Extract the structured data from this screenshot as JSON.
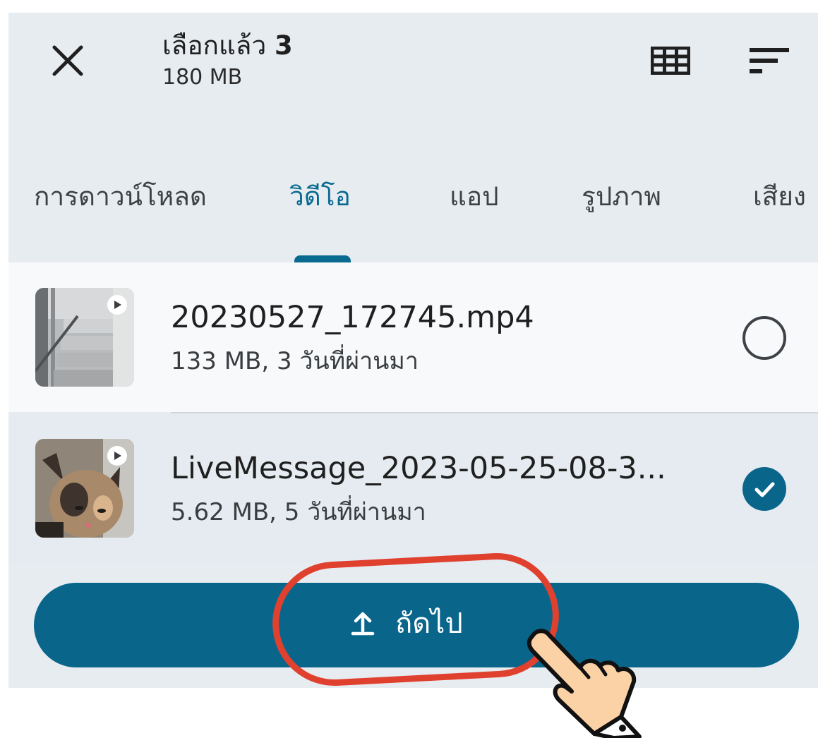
{
  "header": {
    "title_prefix": "เลือกแล้ว",
    "selected_count": "3",
    "total_size": "180 MB"
  },
  "tabs": [
    {
      "label": "การดาวน์โหลด",
      "active": false
    },
    {
      "label": "วิดีโอ",
      "active": true
    },
    {
      "label": "แอป",
      "active": false
    },
    {
      "label": "รูปภาพ",
      "active": false
    },
    {
      "label": "เสียง",
      "active": false
    }
  ],
  "files": [
    {
      "name": "20230527_172745.mp4",
      "meta": "133 MB, 3 วันที่ผ่านมา",
      "selected": false
    },
    {
      "name": "LiveMessage_2023-05-25-08-3...",
      "meta": "5.62 MB, 5 วันที่ผ่านมา",
      "selected": true
    }
  ],
  "next_button": {
    "label": "ถัดไป",
    "icon": "upload-icon"
  },
  "icons": {
    "close": "close-icon",
    "view": "grid-view-icon",
    "sort": "sort-icon",
    "play": "play-icon",
    "check": "check-icon",
    "pointer": "hand-pointer-icon"
  },
  "colors": {
    "accent": "#0a658b",
    "active_tab": "#086a8f",
    "highlight": "#e0412f",
    "background": "#e7ecf1"
  }
}
